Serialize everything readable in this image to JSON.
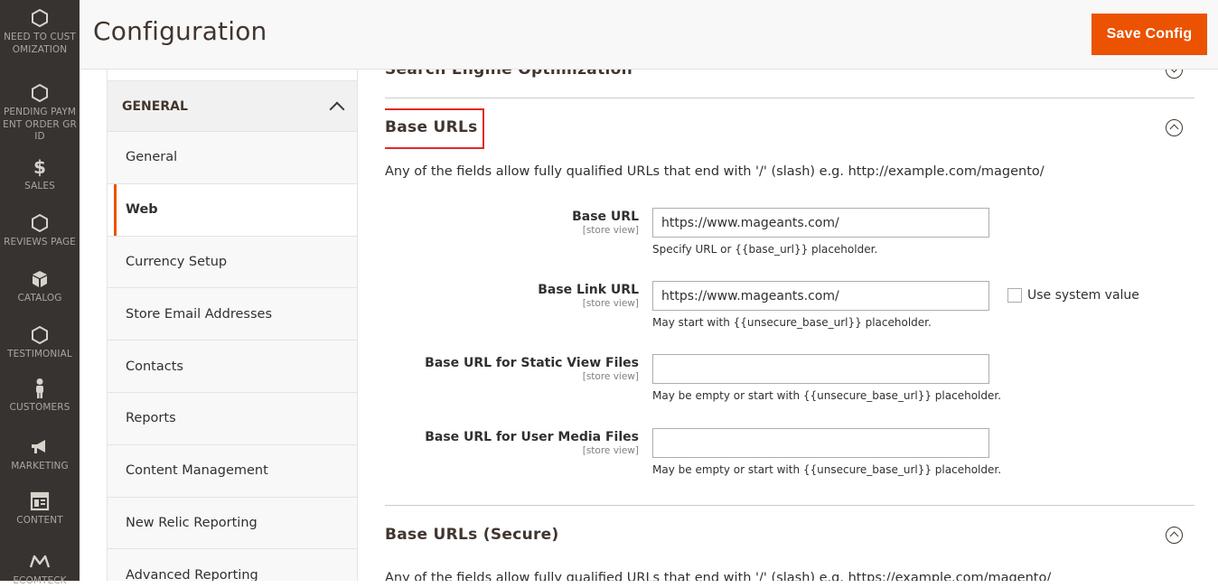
{
  "admin_menu": {
    "items": [
      {
        "label": "NEED TO CUSTOMIZATION",
        "icon": "hexagon-icon"
      },
      {
        "label": "PENDING PAYMENT ORDER GRID",
        "icon": "hexagon-icon"
      },
      {
        "label": "SALES",
        "icon": "dollar-icon"
      },
      {
        "label": "REVIEWS PAGE",
        "icon": "hexagon-icon"
      },
      {
        "label": "CATALOG",
        "icon": "cube-icon"
      },
      {
        "label": "TESTIMONIAL",
        "icon": "hexagon-icon"
      },
      {
        "label": "CUSTOMERS",
        "icon": "person-icon"
      },
      {
        "label": "MARKETING",
        "icon": "megaphone-icon"
      },
      {
        "label": "CONTENT",
        "icon": "layout-icon"
      },
      {
        "label": "ECOMTECK",
        "icon": "m-logo-icon"
      }
    ]
  },
  "header": {
    "title": "Configuration",
    "save_label": "Save Config"
  },
  "config_nav": {
    "group_title": "GENERAL",
    "items": [
      {
        "label": "General",
        "active": false
      },
      {
        "label": "Web",
        "active": true
      },
      {
        "label": "Currency Setup",
        "active": false
      },
      {
        "label": "Store Email Addresses",
        "active": false
      },
      {
        "label": "Contacts",
        "active": false
      },
      {
        "label": "Reports",
        "active": false
      },
      {
        "label": "Content Management",
        "active": false
      },
      {
        "label": "New Relic Reporting",
        "active": false
      },
      {
        "label": "Advanced Reporting",
        "active": false
      }
    ]
  },
  "main": {
    "seo_section_title": "Search Engine Optimization",
    "base_urls": {
      "title": "Base URLs",
      "comment": "Any of the fields allow fully qualified URLs that end with '/' (slash) e.g. http://example.com/magento/",
      "fields": [
        {
          "label": "Base URL",
          "scope": "[store view]",
          "value": "https://www.mageants.com/",
          "note": "Specify URL or {{base_url}} placeholder."
        },
        {
          "label": "Base Link URL",
          "scope": "[store view]",
          "value": "https://www.mageants.com/",
          "note": "May start with {{unsecure_base_url}} placeholder.",
          "use_system_label": "Use system value"
        },
        {
          "label": "Base URL for Static View Files",
          "scope": "[store view]",
          "value": "",
          "note": "May be empty or start with {{unsecure_base_url}} placeholder."
        },
        {
          "label": "Base URL for User Media Files",
          "scope": "[store view]",
          "value": "",
          "note": "May be empty or start with {{unsecure_base_url}} placeholder."
        }
      ]
    },
    "base_urls_secure": {
      "title": "Base URLs (Secure)",
      "comment": "Any of the fields allow fully qualified URLs that end with '/' (slash) e.g. https://example.com/magento/"
    }
  },
  "colors": {
    "accent": "#eb5202",
    "menu_bg": "#373330",
    "highlight": "#e02b27"
  }
}
